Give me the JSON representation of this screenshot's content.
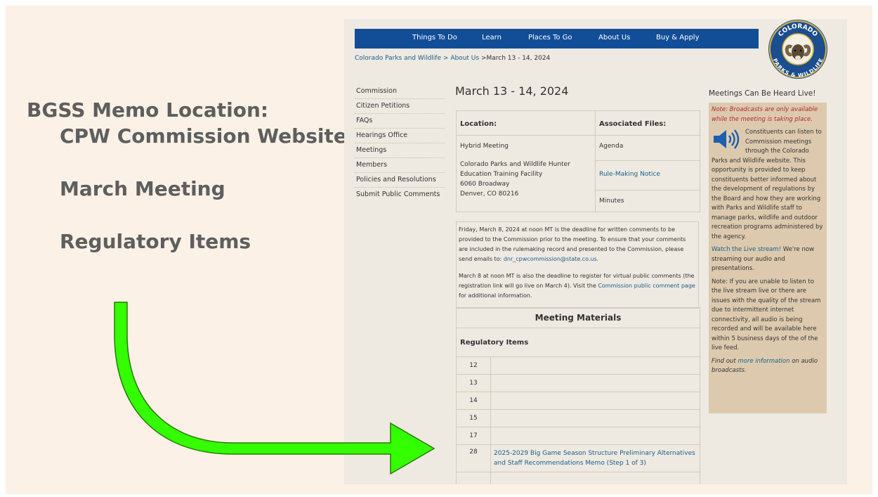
{
  "slide": {
    "title": "BGSS Memo Location:",
    "line2": "CPW Commission Website",
    "line3": "March Meeting",
    "line4": "Regulatory Items",
    "arrow_color": "#33ff00"
  },
  "site": {
    "nav": [
      "Things To Do",
      "Learn",
      "Places To Go",
      "About Us",
      "Buy & Apply"
    ],
    "logo_top_text": "COLORADO",
    "logo_bottom_text": "PARKS & WILDLIFE",
    "breadcrumb": {
      "item1": "Colorado Parks and Wildlife",
      "sep": ">",
      "item2": "About Us",
      "current": "March 13 - 14, 2024"
    },
    "side_menu": [
      "Commission",
      "Citizen Petitions",
      "FAQs",
      "Hearings Office",
      "Meetings",
      "Members",
      "Policies and Resolutions",
      "Submit Public Comments"
    ],
    "page_title": "March 13 - 14, 2024",
    "location_table": {
      "location_header": "Location:",
      "files_header": "Associated Files:",
      "meeting_type": "Hybrid Meeting",
      "address1": "Colorado Parks and Wildlife Hunter",
      "address2": "Education Training Facility",
      "address3": "6060 Broadway",
      "address4": "Denver, CO 80216",
      "file_agenda": "Agenda",
      "file_notice": "Rule-Making Notice",
      "file_minutes": "Minutes"
    },
    "notice": {
      "p1": "Friday, March 8, 2024 at noon MT is the deadline for written comments to be provided to the Commission prior to the meeting. To ensure that your comments are included in the rulemaking record and presented to the Commission, please send emails to:",
      "p1_email": "dnr_cpwcommission@state.co.us",
      "p1_end": ".",
      "p2": "March 8 at noon MT is also the deadline to register for virtual public comments (the registration link will go live on March 4). Visit the",
      "p2_link": "Commission public comment page",
      "p2_end": "for additional information."
    },
    "materials": {
      "heading": "Meeting Materials",
      "regulatory_heading": "Regulatory Items",
      "rows": [
        {
          "num": "12",
          "text": ""
        },
        {
          "num": "13",
          "text": ""
        },
        {
          "num": "14",
          "text": ""
        },
        {
          "num": "15",
          "text": ""
        },
        {
          "num": "17",
          "text": ""
        },
        {
          "num": "28",
          "text": "2025-2029 Big Game Season Structure Preliminary Alternatives and Staff Recommendations Memo (Step 1 of 3)"
        },
        {
          "num": "",
          "text": ""
        }
      ]
    },
    "right": {
      "title": "Meetings Can Be Heard Live!",
      "note_red": "Note: Broadcasts are only available while the meeting is taking place.",
      "p1": "Constituents can listen to Commission meetings through the Colorado Parks and Wildlife website. This opportunity is provided to keep constituents better informed about the development of regulations by the Board and how they are working with Parks and Wildlife staff to manage parks, wildlife and outdoor recreation programs administered by the agency.",
      "p2_link": "Watch the Live stream!",
      "p2": "We're now streaming our audio and presentations.",
      "p3": "Note: If you are unable to listen to the live stream live or there are issues with the quality of the stream due to intermittent internet connectivity, all audio is being recorded and will be available here within 5 business days of the of the live feed.",
      "p4_a": "Find out",
      "p4_link": "more information",
      "p4_b": "on audio broadcasts."
    },
    "colors": {
      "nav_bg": "#124e97",
      "link": "#1a5e8a",
      "sidebar_box": "#ddcaae",
      "note_red": "#b2292e",
      "page_bg": "#eee9e1",
      "slide_bg": "#fbf1e6"
    }
  }
}
